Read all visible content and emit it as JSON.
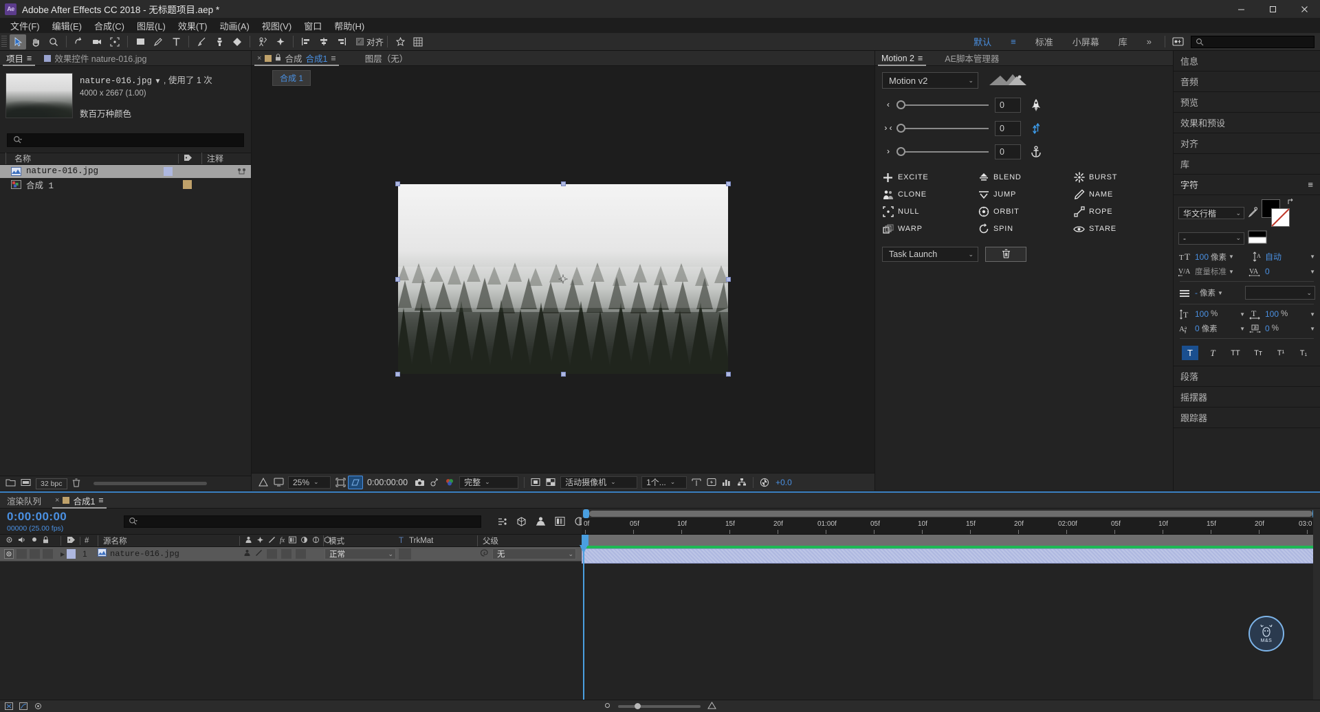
{
  "window": {
    "title": "Adobe After Effects CC 2018 - 无标题项目.aep *",
    "logo": "Ae",
    "minimize": "–",
    "maximize": "□",
    "close": "✕"
  },
  "menubar": {
    "items": [
      "文件(F)",
      "编辑(E)",
      "合成(C)",
      "图层(L)",
      "效果(T)",
      "动画(A)",
      "视图(V)",
      "窗口",
      "帮助(H)"
    ]
  },
  "toolbar": {
    "snap_label": "对齐",
    "snap_checked": "✓",
    "workspaces": [
      "默认",
      "标准",
      "小屏幕",
      "库"
    ],
    "workspace_selected": "默认",
    "overflow": "»",
    "search_placeholder": ""
  },
  "project_panel": {
    "tabs": [
      {
        "label": "项目",
        "active": true
      },
      {
        "label": "效果控件 nature-016.jpg",
        "active": false
      }
    ],
    "menu_icon": "≡",
    "asset": {
      "name": "nature-016.jpg",
      "dropdown": "▼",
      "usage": ", 使用了 1 次",
      "dimensions": "4000 x 2667 (1.00)",
      "color_depth": "数百万种颜色"
    },
    "search_placeholder": "",
    "columns": [
      "名称",
      "",
      "注释"
    ],
    "rows": [
      {
        "name": "nature-016.jpg",
        "type": "footage",
        "color": "#aeb8e0",
        "selected": true
      },
      {
        "name": "合成 1",
        "type": "comp",
        "color": "#bfa16a",
        "selected": false
      }
    ],
    "footer": {
      "bpc": "32 bpc"
    }
  },
  "comp_panel": {
    "tabs": [
      {
        "close": "×",
        "label_prefix": "合成",
        "label_name": "合成1",
        "menu": "≡",
        "active": true
      },
      {
        "label": "图层（无）",
        "active": false
      }
    ],
    "breadcrumb": "合成 1",
    "bottom_bar": {
      "zoom": "25%",
      "time": "0:00:00:00",
      "resolution": "完整",
      "camera": "活动摄像机",
      "views": "1个...",
      "exposure": "+0.0"
    }
  },
  "motion_panel": {
    "tabs": [
      {
        "label": "Motion 2",
        "active": true,
        "menu": "≡"
      },
      {
        "label": "AE脚本管理器",
        "active": false
      }
    ],
    "version_select": "Motion v2",
    "sliders": [
      {
        "icon": "‹",
        "value": "0",
        "right_icon": "rocket-icon"
      },
      {
        "icon": "›‹",
        "value": "0",
        "right_icon": "vertical-arrows-icon"
      },
      {
        "icon": "›",
        "value": "0",
        "right_icon": "anchor-icon"
      }
    ],
    "tools": [
      {
        "label": "EXCITE",
        "icon": "plus-icon"
      },
      {
        "label": "BLEND",
        "icon": "blend-icon"
      },
      {
        "label": "BURST",
        "icon": "burst-icon"
      },
      {
        "label": "CLONE",
        "icon": "clone-icon"
      },
      {
        "label": "JUMP",
        "icon": "jump-icon"
      },
      {
        "label": "NAME",
        "icon": "pencil-icon"
      },
      {
        "label": "NULL",
        "icon": "null-icon"
      },
      {
        "label": "ORBIT",
        "icon": "orbit-icon"
      },
      {
        "label": "ROPE",
        "icon": "rope-icon"
      },
      {
        "label": "WARP",
        "icon": "warp-icon"
      },
      {
        "label": "SPIN",
        "icon": "spin-icon"
      },
      {
        "label": "STARE",
        "icon": "eye-icon"
      }
    ],
    "task_select": "Task Launch",
    "trash_icon": "trash-icon"
  },
  "right_dock": {
    "items": [
      "信息",
      "音频",
      "预览",
      "效果和预设",
      "对齐",
      "库"
    ],
    "character": {
      "title": "字符",
      "menu": "≡",
      "font_family": "华文行楷",
      "font_style": "-",
      "font_size": "100",
      "font_size_unit": "像素",
      "leading": "自动",
      "kerning_label": "度量标准",
      "tracking": "0",
      "stroke_width": "-",
      "stroke_width_unit": "像素",
      "stroke_type": "",
      "vertical_scale": "100",
      "vertical_scale_unit": "%",
      "horizontal_scale": "100",
      "horizontal_scale_unit": "%",
      "baseline_shift": "0",
      "baseline_unit": "像素",
      "tsume": "0",
      "tsume_unit": "%",
      "styles": [
        "T",
        "T",
        "TT",
        "Tᴛ",
        "T¹",
        "T₁"
      ],
      "style_active_index": 0
    },
    "footer_items": [
      "段落",
      "摇摆器",
      "跟踪器"
    ]
  },
  "timeline": {
    "tabs": [
      {
        "label": "渲染队列",
        "active": false
      },
      {
        "close": "×",
        "label": "合成1",
        "menu": "≡",
        "active": true
      }
    ],
    "current_time": "0:00:00:00",
    "frame_info": "00000 (25.00 fps)",
    "search_placeholder": "",
    "columns": {
      "source_name": "源名称",
      "number": "#",
      "mode": "模式",
      "trkmat_t": "T",
      "trkmat": "TrkMat",
      "parent": "父级"
    },
    "layers": [
      {
        "index": "1",
        "name": "nature-016.jpg",
        "mode": "正常",
        "trkmat": "",
        "parent": "无",
        "color": "#aeb8e0"
      }
    ],
    "ruler_labels": [
      "0f",
      "05f",
      "10f",
      "15f",
      "20f",
      "01:00f",
      "05f",
      "10f",
      "15f",
      "20f",
      "02:00f",
      "05f",
      "10f",
      "15f",
      "20f",
      "03:0"
    ]
  },
  "badge": {
    "text": "M&S",
    "icon": "deer-icon"
  },
  "colors": {
    "accent_blue": "#4a90e2",
    "panel_bg": "#232323",
    "tab_bg": "#2b2b2b",
    "layer_purple": "#aeb8e0",
    "comp_gold": "#bfa16a",
    "green_bar": "#1db954"
  }
}
